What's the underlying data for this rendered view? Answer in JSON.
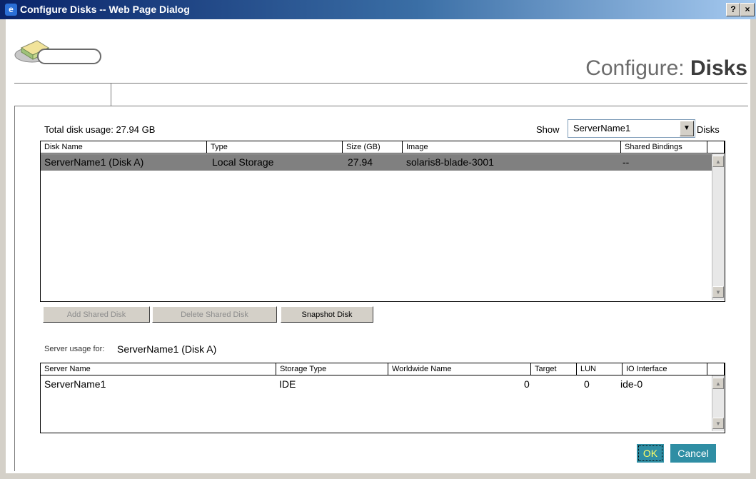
{
  "window": {
    "title": "Configure Disks -- Web Page Dialog",
    "help_glyph": "?",
    "close_glyph": "×"
  },
  "header": {
    "title_prefix": "Configure: ",
    "title_bold": "Disks"
  },
  "disks": {
    "total_usage": "Total disk usage: 27.94 GB",
    "show_label": "Show",
    "show_selected": "ServerName1",
    "show_suffix": "Disks",
    "columns": [
      "Disk Name",
      "Type",
      "Size (GB)",
      "Image",
      "Shared Bindings"
    ],
    "rows": [
      {
        "name": "ServerName1 (Disk A)",
        "type": "Local Storage",
        "size": "27.94",
        "image": "solaris8-blade-3001",
        "bindings": "--"
      }
    ]
  },
  "buttons": {
    "add_shared": "Add Shared Disk",
    "delete_shared": "Delete Shared Disk",
    "snapshot": "Snapshot Disk",
    "ok": "OK",
    "cancel": "Cancel"
  },
  "server_usage": {
    "label": "Server usage for:",
    "target": "ServerName1 (Disk A)",
    "columns": [
      "Server Name",
      "Storage Type",
      "Worldwide Name",
      "Target",
      "LUN",
      "IO Interface"
    ],
    "rows": [
      {
        "server": "ServerName1",
        "storage": "IDE",
        "wwn": "",
        "target": "0",
        "lun": "0",
        "io": "ide-0"
      }
    ]
  },
  "colors": {
    "selected_row": "#808080",
    "ok_bg": "#2f8ea4",
    "ok_text": "#ffff66",
    "titlebar": "#0a246a"
  },
  "icons": {
    "app": "ie-icon",
    "header": "disk-drive-icon"
  }
}
